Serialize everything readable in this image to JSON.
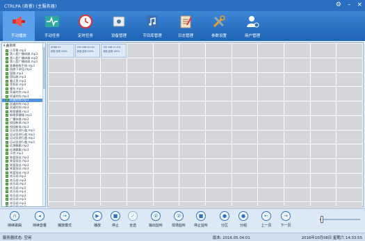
{
  "window": {
    "title": "CTRLPA (商睿) (主服务器)"
  },
  "toolbar": {
    "items": [
      {
        "label": "手动播放",
        "icon": "speaker-icon",
        "active": true
      },
      {
        "label": "手动任务",
        "icon": "waveform-icon"
      },
      {
        "label": "定时任务",
        "icon": "clock-icon"
      },
      {
        "label": "设备管理",
        "icon": "device-icon"
      },
      {
        "label": "节目库管理",
        "icon": "music-library-icon"
      },
      {
        "label": "日志管理",
        "icon": "log-icon"
      },
      {
        "label": "参数设置",
        "icon": "tools-icon"
      },
      {
        "label": "用户管理",
        "icon": "user-icon"
      }
    ]
  },
  "tree": {
    "root": "曲目库",
    "items": [
      "小苹果.mp3",
      "第八套广播体操.mp3",
      "第八套广播体操.mp3",
      "第八套广播体操.mp3",
      "青春修炼手册.mp3",
      "国旗下讲话.mp3",
      "国歌.mp3",
      "国际歌.mp3",
      "春天里.mp3",
      "茉莉花.mp3",
      "童年.mp3",
      "同桌的你.mp3",
      "同桌的你.mp3",
      "同桌的你.mp3",
      "同桌的你.mp3",
      "同桌的你.mp3",
      "眼保健操.mp3",
      "新眼保健操.mp3",
      "广播体操.mp3",
      "校园新闻.mp3",
      "校园新闻.mp3",
      "运动员进行曲.mp3",
      "运动员进行曲.mp3",
      "运动员进行曲.mp3",
      "运动员进行曲.mp3",
      "红旗飘飘.mp3",
      "红旗飘飘.mp3",
      "卡农.mp3",
      "致爱丽丝.mp3",
      "致爱丽丝.mp3",
      "致爱丽丝.mp3",
      "致爱丽丝.mp3",
      "致爱丽丝.mp3",
      "欢乐颂.mp3",
      "欢乐颂.mp3",
      "欢乐颂.mp3",
      "欢乐颂.mp3",
      "欢乐颂.mp3",
      "欢乐颂.mp3",
      "欢乐颂.mp3",
      "欢乐颂.mp3",
      "欢乐颂.mp3",
      "欢乐颂.mp3",
      "欢乐颂.mp3"
    ],
    "selected_index": 13
  },
  "grid": {
    "occupied": [
      {
        "line1": "ZONE-01",
        "line2": "状态:空闲  100%"
      },
      {
        "line1": "192.168.10.101",
        "line2": "状态:空闲  100%"
      },
      {
        "line1": "192.168.10.102",
        "line2": "状态:空闲  100%"
      }
    ]
  },
  "controls": {
    "buttons": [
      {
        "label": "持续歌曲",
        "icon": "headphones-icon"
      },
      {
        "label": "持续音量",
        "icon": "volume-icon"
      },
      {
        "label": "播放模式",
        "icon": "play-mode-icon"
      },
      {
        "label": "播放",
        "icon": "play-icon"
      },
      {
        "label": "停止",
        "icon": "stop-icon"
      },
      {
        "label": "全选",
        "icon": "check-icon"
      },
      {
        "label": "输出监听",
        "icon": "ear-icon"
      },
      {
        "label": "现场监听",
        "icon": "ear-icon"
      },
      {
        "label": "停止监听",
        "icon": "stop-listen-icon"
      },
      {
        "label": "分区",
        "icon": "zone-icon"
      },
      {
        "label": "分组",
        "icon": "group-icon"
      },
      {
        "label": "上一页",
        "icon": "left-arrow-icon"
      },
      {
        "label": "下一页",
        "icon": "right-arrow-icon"
      }
    ],
    "volume_fraction": 0.05
  },
  "status": {
    "server": "服务器状态: 空闲",
    "version": "版本: 2016.05.04.01",
    "datetime": "2016年10月08日  星期六  14:33:55"
  }
}
